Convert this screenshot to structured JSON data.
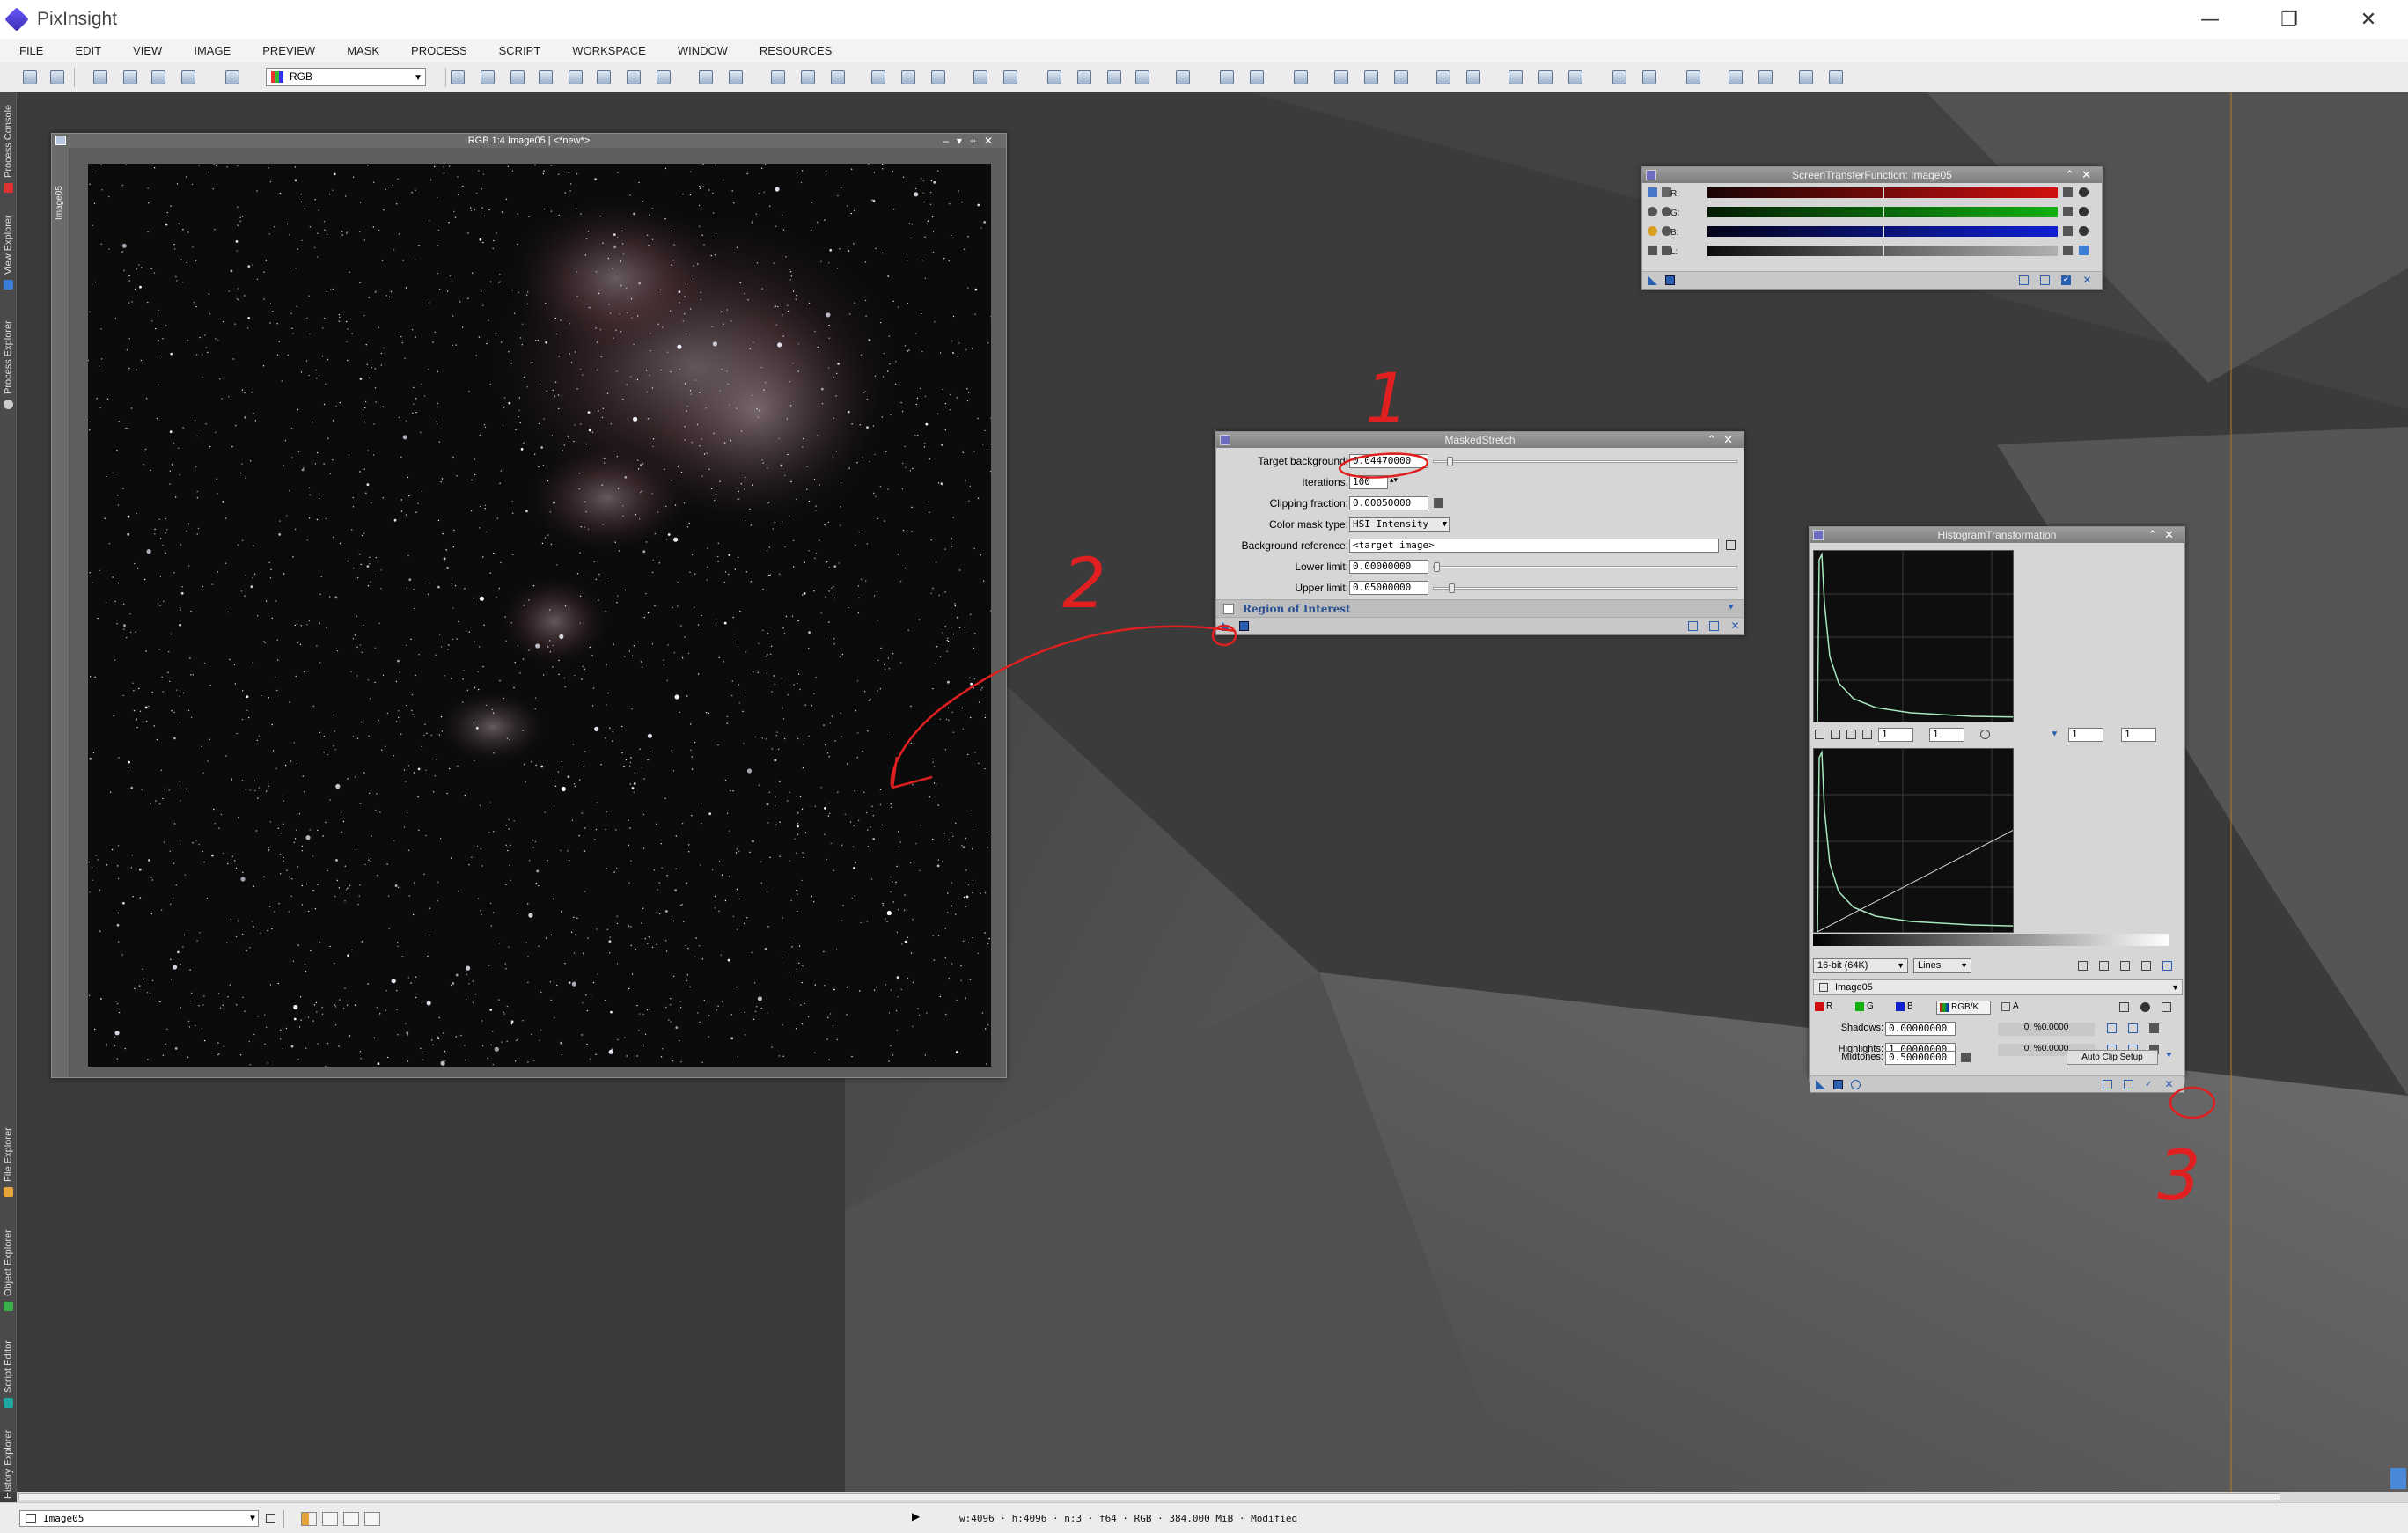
{
  "app": {
    "title": "PixInsight"
  },
  "window_controls": {
    "minimize": "—",
    "maximize": "❐",
    "close": "✕"
  },
  "menu": [
    "FILE",
    "EDIT",
    "VIEW",
    "IMAGE",
    "PREVIEW",
    "MASK",
    "PROCESS",
    "SCRIPT",
    "WORKSPACE",
    "WINDOW",
    "RESOURCES"
  ],
  "toolbar": {
    "color_space_select": "RGB"
  },
  "side_tabs": {
    "top": [
      "Process Console",
      "View Explorer",
      "Process Explorer"
    ],
    "bottom": [
      "File Explorer",
      "Object Explorer",
      "Script Editor",
      "History Explorer"
    ]
  },
  "image_window": {
    "title": "RGB 1:4 Image05 | <*new*>",
    "side_tab": "Image05"
  },
  "stf": {
    "title": "ScreenTransferFunction: Image05",
    "channels": [
      {
        "label": "R:",
        "color": "#d01010"
      },
      {
        "label": "G:",
        "color": "#10b010"
      },
      {
        "label": "B:",
        "color": "#1020d0"
      },
      {
        "label": "L:",
        "color": "#b0b0b0"
      }
    ]
  },
  "masked_stretch": {
    "title": "MaskedStretch",
    "fields": {
      "target_background": {
        "label": "Target background:",
        "value": "0.04470000",
        "slider": 0.045
      },
      "iterations": {
        "label": "Iterations:",
        "value": "100"
      },
      "clipping_fraction": {
        "label": "Clipping fraction:",
        "value": "0.00050000"
      },
      "color_mask_type": {
        "label": "Color mask type:",
        "value": "HSI Intensity"
      },
      "background_reference": {
        "label": "Background reference:",
        "value": "<target image>"
      },
      "lower_limit": {
        "label": "Lower limit:",
        "value": "0.00000000",
        "slider": 0.0
      },
      "upper_limit": {
        "label": "Upper limit:",
        "value": "0.05000000",
        "slider": 0.05
      }
    },
    "roi": "Region of Interest"
  },
  "histogram": {
    "title": "HistogramTransformation",
    "zoom_values": [
      "1",
      "1",
      "1",
      "1"
    ],
    "resolution": "16-bit (64K)",
    "graph_style": "Lines",
    "view": "Image05",
    "channel_buttons": [
      "R",
      "G",
      "B",
      "RGB/K",
      "A"
    ],
    "shadows": {
      "label": "Shadows:",
      "value": "0.00000000",
      "clip": "0, %0.0000"
    },
    "highlights": {
      "label": "Highlights:",
      "value": "1.00000000",
      "clip": "0, %0.0000"
    },
    "midtones": {
      "label": "Midtones:",
      "value": "0.50000000"
    },
    "auto_clip": "Auto Clip Setup"
  },
  "annotations": {
    "one": "1",
    "two": "2",
    "three": "3"
  },
  "statusbar": {
    "view_select": "Image05",
    "info": "w:4096 · h:4096 · n:3 · f64 · RGB · 384.000 MiB · Modified"
  }
}
